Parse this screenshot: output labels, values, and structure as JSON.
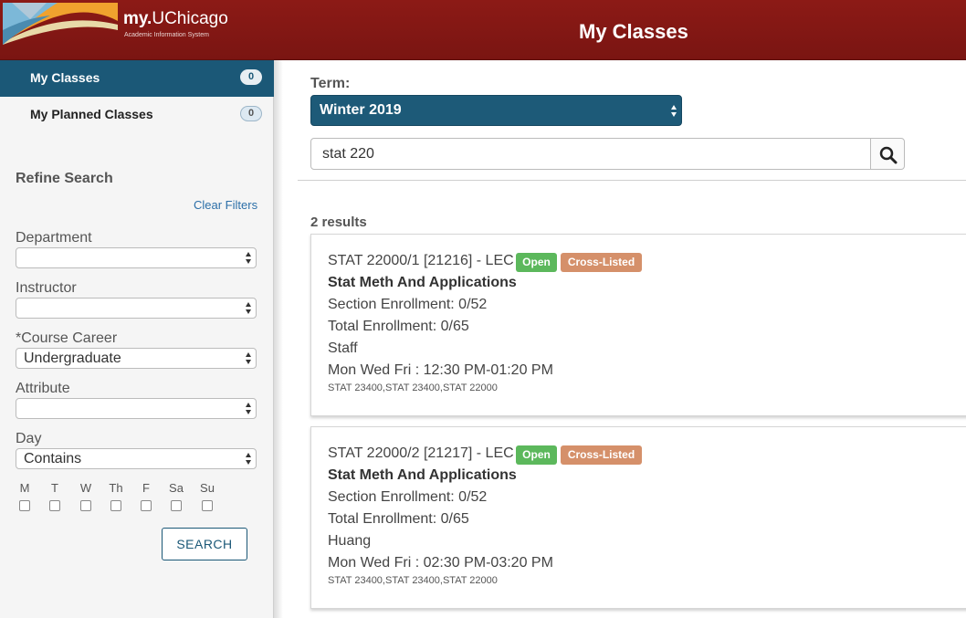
{
  "header": {
    "brand_prefix": "my.",
    "brand_name": "UChicago",
    "brand_tagline": "Academic Information System",
    "page_title": "My Classes"
  },
  "sidebar": {
    "nav": [
      {
        "label": "My Classes",
        "count": "0",
        "active": true
      },
      {
        "label": "My Planned Classes",
        "count": "0",
        "active": false
      }
    ],
    "refine_title": "Refine Search",
    "clear_filters": "Clear Filters",
    "filters": {
      "department_label": "Department",
      "department_value": "",
      "instructor_label": "Instructor",
      "instructor_value": "",
      "career_label": "*Course Career",
      "career_value": "Undergraduate",
      "attribute_label": "Attribute",
      "attribute_value": "",
      "day_label": "Day",
      "day_value": "Contains"
    },
    "days": [
      "M",
      "T",
      "W",
      "Th",
      "F",
      "Sa",
      "Su"
    ],
    "search_button": "SEARCH"
  },
  "main": {
    "term_label": "Term:",
    "term_value": "Winter 2019",
    "search_value": "stat 220",
    "results_count": "2 results",
    "results": [
      {
        "course_id": "STAT 22000/1 [21216] - LEC",
        "status": "Open",
        "tag": "Cross-Listed",
        "title": "Stat Meth And Applications",
        "section_enrollment": "Section Enrollment: 0/52",
        "total_enrollment": "Total Enrollment: 0/65",
        "instructor": "Staff",
        "schedule": "Mon Wed Fri : 12:30 PM-01:20 PM",
        "cross_listings": "STAT 23400,STAT 23400,STAT 22000"
      },
      {
        "course_id": "STAT 22000/2 [21217] - LEC",
        "status": "Open",
        "tag": "Cross-Listed",
        "title": "Stat Meth And Applications",
        "section_enrollment": "Section Enrollment: 0/52",
        "total_enrollment": "Total Enrollment: 0/65",
        "instructor": "Huang",
        "schedule": "Mon Wed Fri : 02:30 PM-03:20 PM",
        "cross_listings": "STAT 23400,STAT 23400,STAT 22000"
      }
    ]
  },
  "colors": {
    "header_maroon": "#8c1a16",
    "nav_active": "#1b5877",
    "open_badge": "#5cb85c",
    "cross_listed_badge": "#d5906a",
    "link_blue": "#2c6fa8"
  },
  "icons": {
    "search": "magnifier-icon",
    "select_arrows": "select-arrows-icon"
  }
}
